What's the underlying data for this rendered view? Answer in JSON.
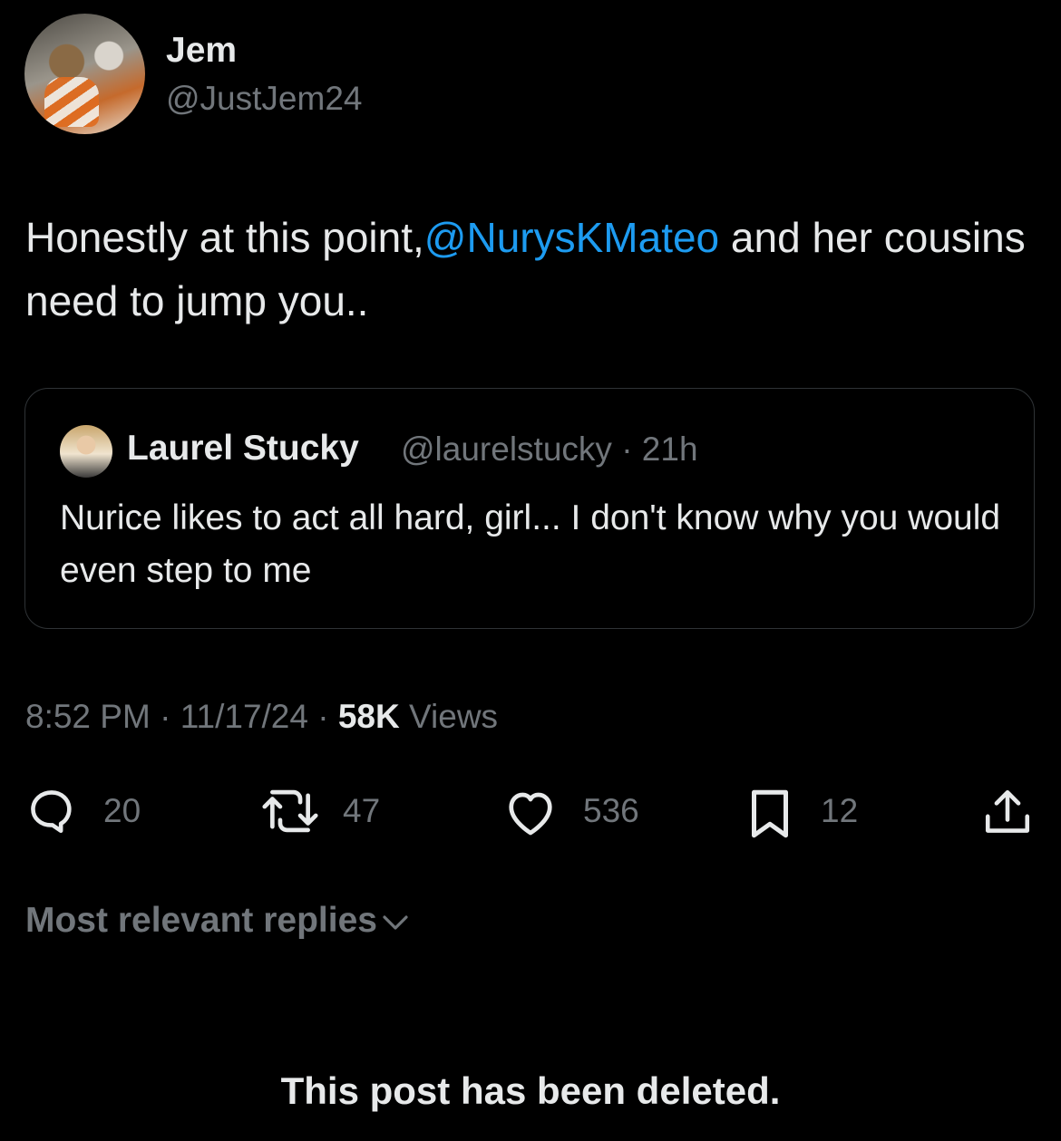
{
  "author": {
    "name": "Jem",
    "handle": "@JustJem24"
  },
  "tweet": {
    "text_before": "Honestly at this point,",
    "mention": "@NurysKMateo",
    "text_after": " and her cousins need to jump you.."
  },
  "quote": {
    "name": "Laurel Stucky",
    "handle": "@laurelstucky",
    "time": "· 21h",
    "text": "Nurice likes to act all hard, girl... I don't know why you would even step to me"
  },
  "meta": {
    "time": "8:52 PM",
    "sep1": " · ",
    "date": "11/17/24",
    "sep2": " · ",
    "views_count": "58K",
    "views_label": " Views"
  },
  "actions": {
    "replies": "20",
    "reposts": "47",
    "likes": "536",
    "bookmarks": "12"
  },
  "replies_sort": {
    "label": "Most relevant replies"
  },
  "deleted_notice": "This post has been deleted.",
  "colors": {
    "background": "#000000",
    "text": "#e7e9ea",
    "secondary": "#71767b",
    "link": "#1d9bf0",
    "border": "#2f3336"
  },
  "icons": [
    "reply-icon",
    "repost-icon",
    "like-icon",
    "bookmark-icon",
    "share-icon",
    "chevron-down-icon"
  ]
}
